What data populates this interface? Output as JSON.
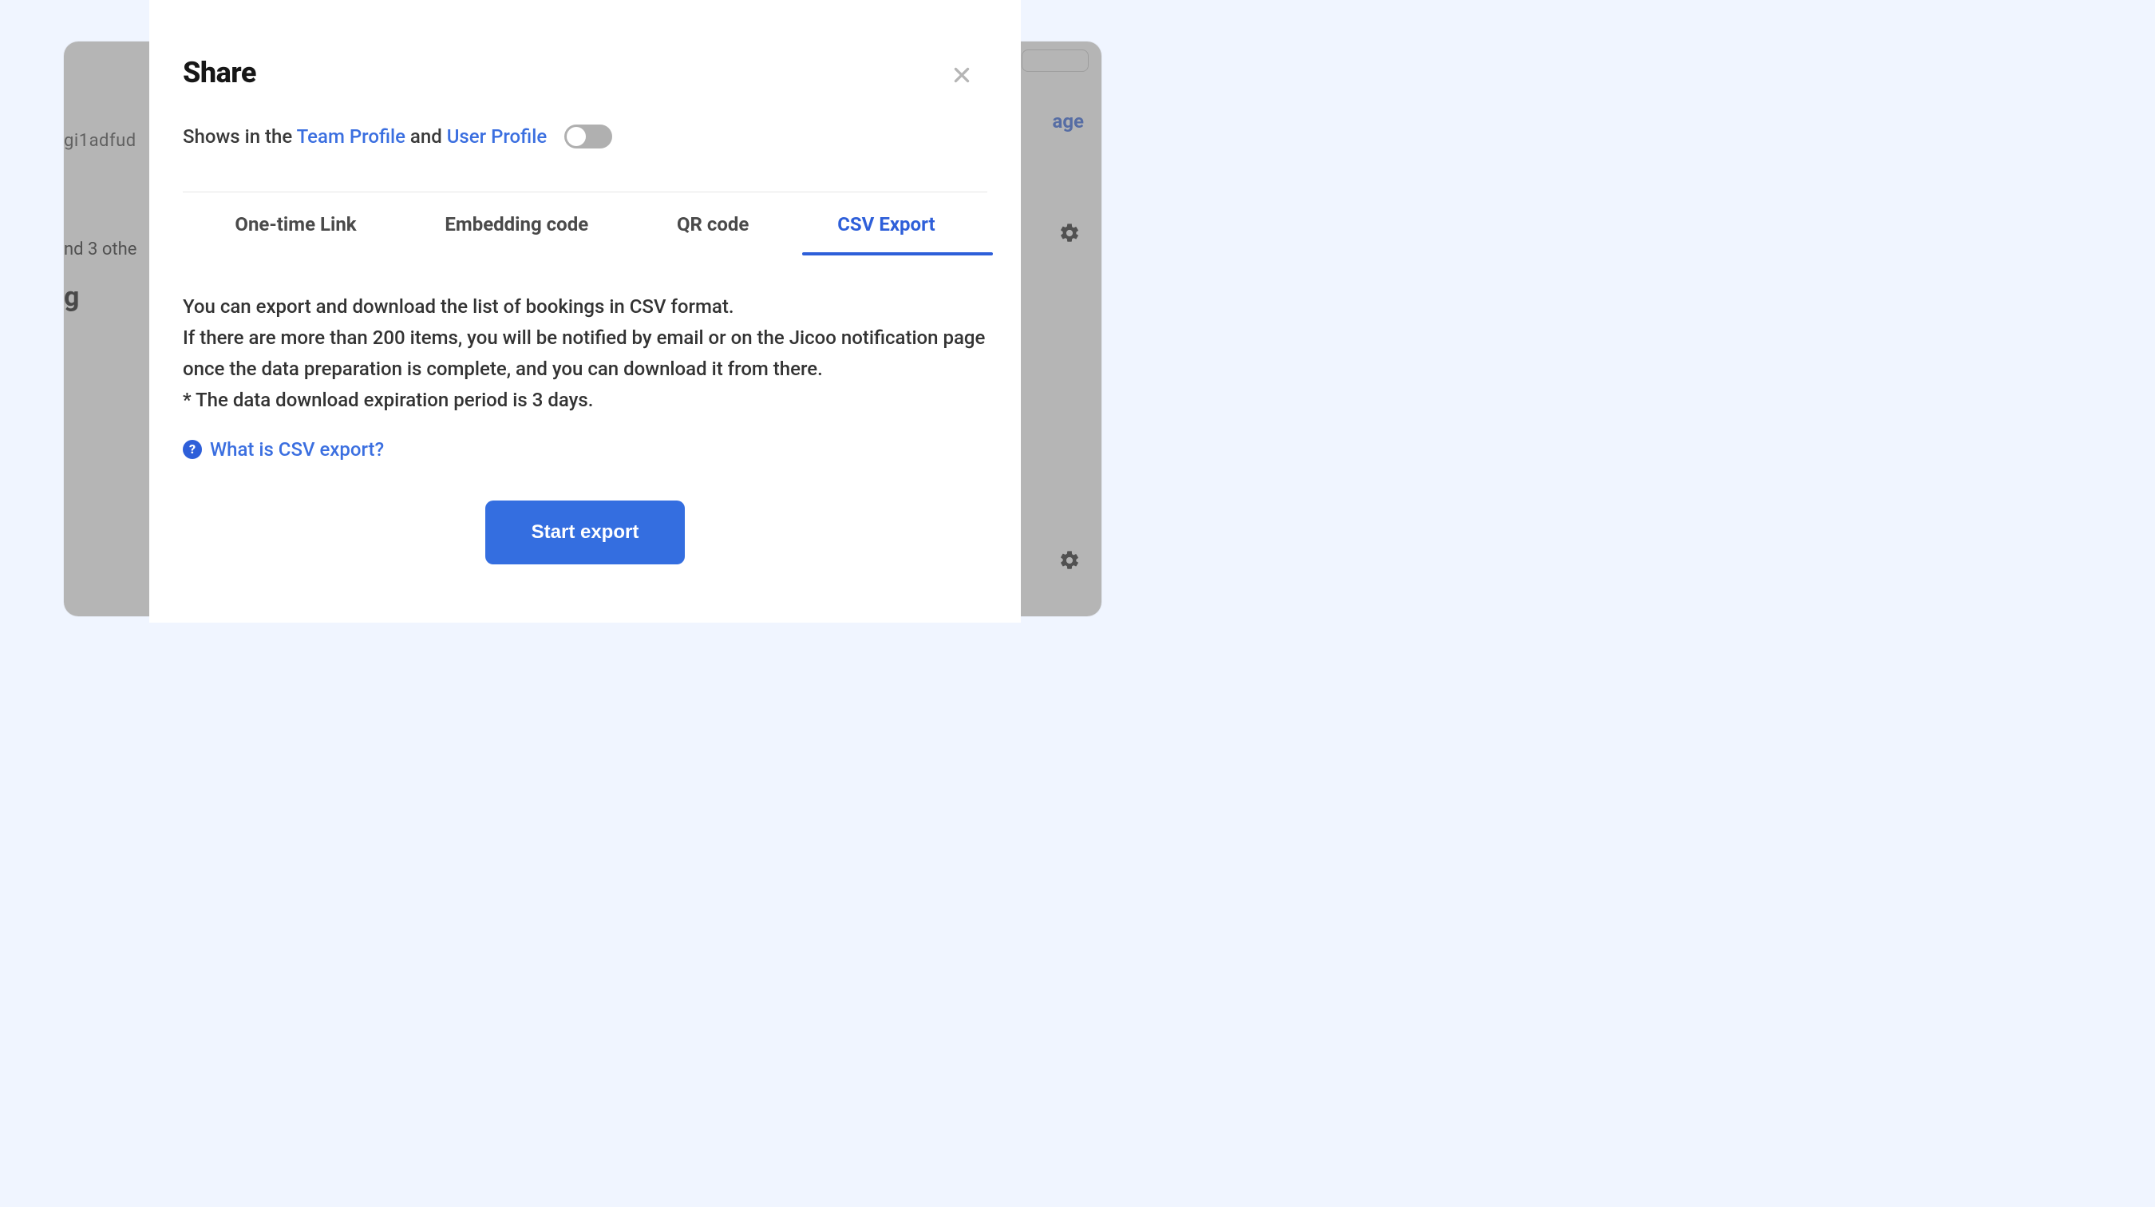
{
  "background": {
    "url_fragment": "gi1adfud",
    "others_fragment": "nd 3 othe",
    "title_fragment": "g",
    "sub_fragment": "",
    "right_link_fragment": "age"
  },
  "modal": {
    "title": "Share",
    "subtitle": {
      "prefix": "Shows in the ",
      "team_link": "Team Profile",
      "conjunction": " and ",
      "user_link": "User Profile"
    },
    "toggle_on": false,
    "tabs": [
      {
        "label": "One-time Link",
        "active": false
      },
      {
        "label": "Embedding code",
        "active": false
      },
      {
        "label": "QR code",
        "active": false
      },
      {
        "label": "CSV Export",
        "active": true
      }
    ],
    "body_p1": "You can export and download the list of bookings in CSV format.",
    "body_p2": "If there are more than 200 items, you will be notified by email or on the Jicoo notification page once the data preparation is complete, and you can download it from there.",
    "body_p3": "* The data download expiration period is 3 days.",
    "help_link": "What is CSV export?",
    "primary_button": "Start export"
  }
}
